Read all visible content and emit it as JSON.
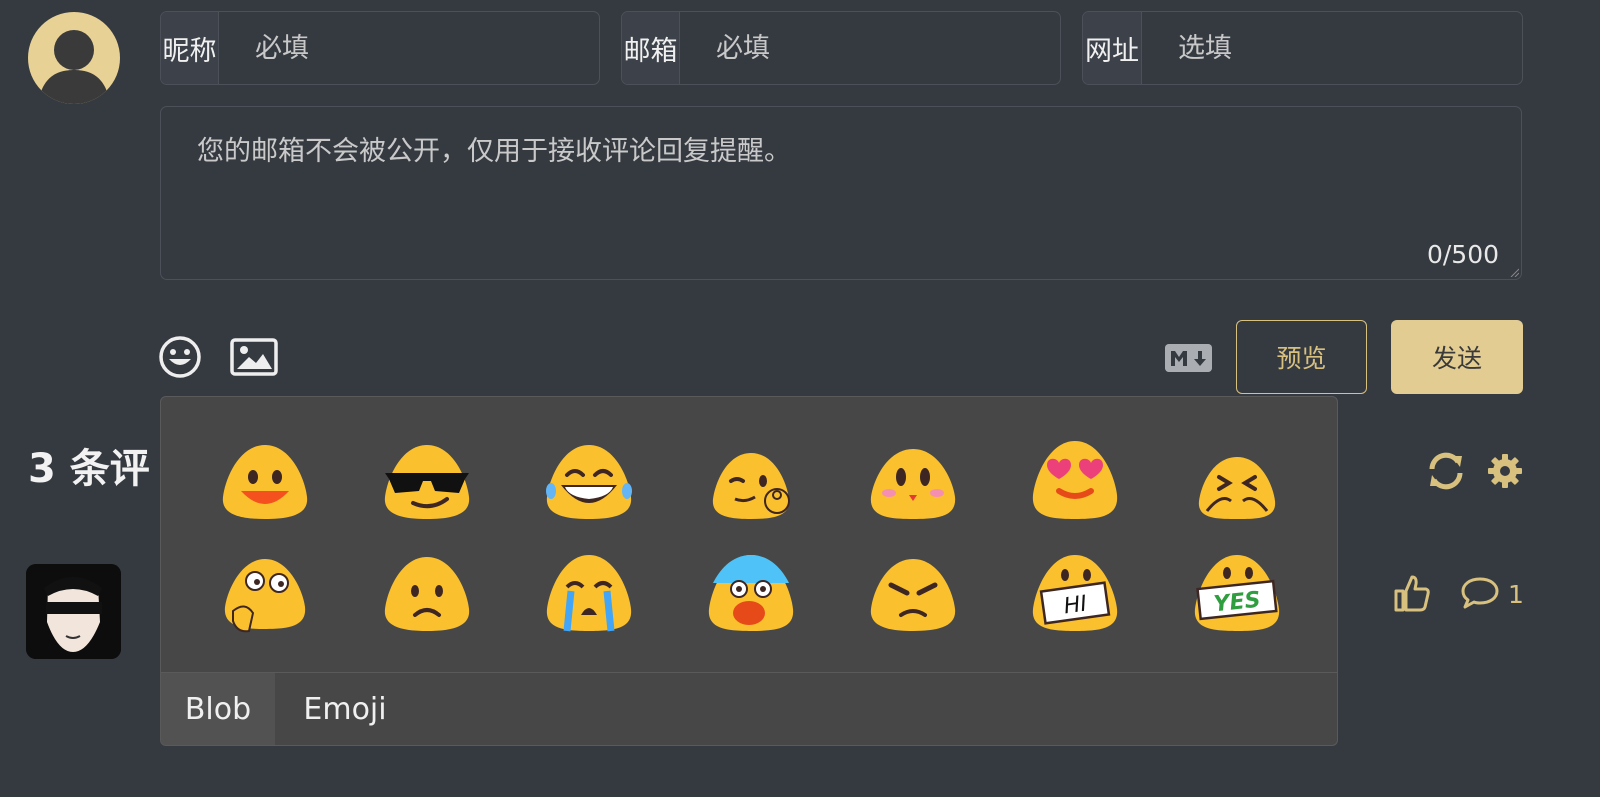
{
  "form": {
    "nickname": {
      "label": "昵称",
      "placeholder": "必填"
    },
    "email": {
      "label": "邮箱",
      "placeholder": "必填"
    },
    "website": {
      "label": "网址",
      "placeholder": "选填"
    },
    "editor_placeholder": "您的邮箱不会被公开，仅用于接收评论回复提醒。",
    "counter": "0/500"
  },
  "actions": {
    "preview_label": "预览",
    "send_label": "发送"
  },
  "comments": {
    "title": "3 条评",
    "reply_count": "1"
  },
  "emoji_panel": {
    "tabs": [
      "Blob",
      "Emoji"
    ],
    "active_tab": "Blob",
    "emojis": [
      "blob-smile",
      "blob-sunglasses",
      "blob-grin",
      "blob-wink-ok",
      "blob-blush",
      "blob-heart-eyes",
      "blob-laughing-hug",
      "blob-thinking",
      "blob-frown",
      "blob-sob",
      "blob-scream",
      "blob-angry",
      "blob-hi",
      "blob-yes"
    ],
    "sign_hi": "HI",
    "sign_yes": "YES"
  },
  "colors": {
    "background": "#353a41",
    "accent": "#d8c07f",
    "send_button": "#e3cc92",
    "emoji_yellow": "#fbc02d"
  }
}
